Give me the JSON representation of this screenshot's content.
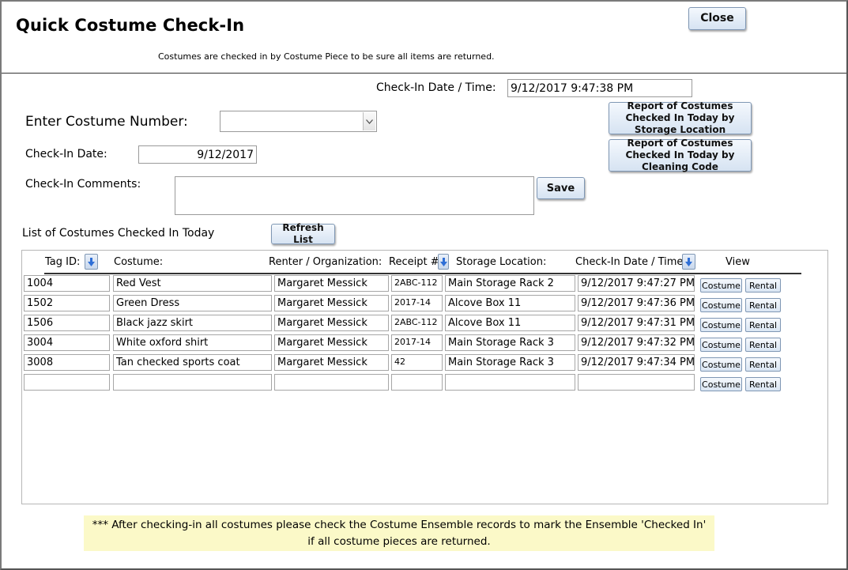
{
  "header": {
    "title": "Quick Costume Check-In",
    "subtitle": "Costumes are checked in by Costume Piece to be sure all items are returned.",
    "close_label": "Close"
  },
  "form": {
    "checkin_datetime_label": "Check-In Date / Time:",
    "checkin_datetime_value": "9/12/2017 9:47:38 PM",
    "costume_number_label": "Enter Costume Number:",
    "costume_number_value": "",
    "checkin_date_label": "Check-In Date:",
    "checkin_date_value": "9/12/2017",
    "comments_label": "Check-In Comments:",
    "comments_value": "",
    "save_label": "Save",
    "report_storage_label": "Report of Costumes Checked In Today by Storage Location",
    "report_cleaning_label": "Report of Costumes Checked In Today by Cleaning Code"
  },
  "list": {
    "title": "List of Costumes Checked In Today",
    "refresh_label": "Refresh List",
    "columns": {
      "tag": "Tag ID:",
      "costume": "Costume:",
      "renter": "Renter / Organization:",
      "receipt": "Receipt #:",
      "storage": "Storage Location:",
      "checkin": "Check-In Date / Time",
      "view": "View"
    },
    "costume_button_label": "Costume",
    "rental_button_label": "Rental",
    "rows": [
      {
        "tag": "1004",
        "costume": "Red Vest",
        "renter": "Margaret Messick",
        "receipt": "2ABC-112",
        "storage": "Main Storage Rack 2",
        "checkin": "9/12/2017 9:47:27 PM"
      },
      {
        "tag": "1502",
        "costume": "Green Dress",
        "renter": "Margaret Messick",
        "receipt": "2017-14",
        "storage": "Alcove Box 11",
        "checkin": "9/12/2017 9:47:36 PM"
      },
      {
        "tag": "1506",
        "costume": "Black jazz skirt",
        "renter": "Margaret Messick",
        "receipt": "2ABC-112",
        "storage": "Alcove Box 11",
        "checkin": "9/12/2017 9:47:31 PM"
      },
      {
        "tag": "3004",
        "costume": "White oxford shirt",
        "renter": "Margaret Messick",
        "receipt": "2017-14",
        "storage": "Main Storage Rack 3",
        "checkin": "9/12/2017 9:47:32 PM"
      },
      {
        "tag": "3008",
        "costume": "Tan checked sports coat",
        "renter": "Margaret Messick",
        "receipt": "42",
        "storage": "Main Storage Rack 3",
        "checkin": "9/12/2017 9:47:34 PM"
      },
      {
        "tag": "",
        "costume": "",
        "renter": "",
        "receipt": "",
        "storage": "",
        "checkin": ""
      }
    ]
  },
  "footer": {
    "note_line1": "*** After checking-in all costumes please check the Costume Ensemble records to mark the Ensemble 'Checked In'",
    "note_line2": "if all costume pieces are returned."
  },
  "icons": {
    "sort": "sort-descending-icon",
    "dropdown": "chevron-down-icon"
  },
  "colors": {
    "button_border": "#7f97b4",
    "note_background": "#fbf9c8",
    "sort_arrow": "#2f6fd6"
  }
}
